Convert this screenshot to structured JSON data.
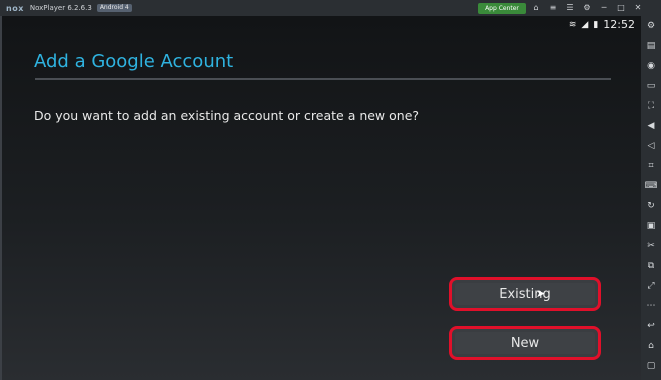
{
  "window": {
    "logo": "nox",
    "app_name": "NoxPlayer 6.2.6.3",
    "android_badge": "Android 4",
    "app_center": "App Center"
  },
  "titlebar_icons": [
    "bag-icon",
    "menu-icon",
    "settings-icon",
    "minimize-icon",
    "maximize-icon",
    "close-icon"
  ],
  "status_bar": {
    "time": "12:52",
    "icons": [
      "wifi-icon",
      "signal-icon",
      "battery-icon"
    ]
  },
  "dialog": {
    "title": "Add a Google Account",
    "question": "Do you want to add an existing account or create a new one?",
    "existing_label": "Existing",
    "new_label": "New"
  },
  "colors": {
    "title": "#2fb3e0",
    "highlight": "#e0102a",
    "background": "#1b1d20"
  },
  "sidebar_icons": [
    "gear-icon",
    "toolbox-icon",
    "location-icon",
    "screen-icon",
    "fullscreen-icon",
    "volume-up-icon",
    "volume-down-icon",
    "scan-icon",
    "keyboard-icon",
    "rotate-icon",
    "apk-icon",
    "cut-icon",
    "multi-instance-icon",
    "resize-icon",
    "more-icon",
    "back-icon",
    "home-icon",
    "recent-icon"
  ]
}
